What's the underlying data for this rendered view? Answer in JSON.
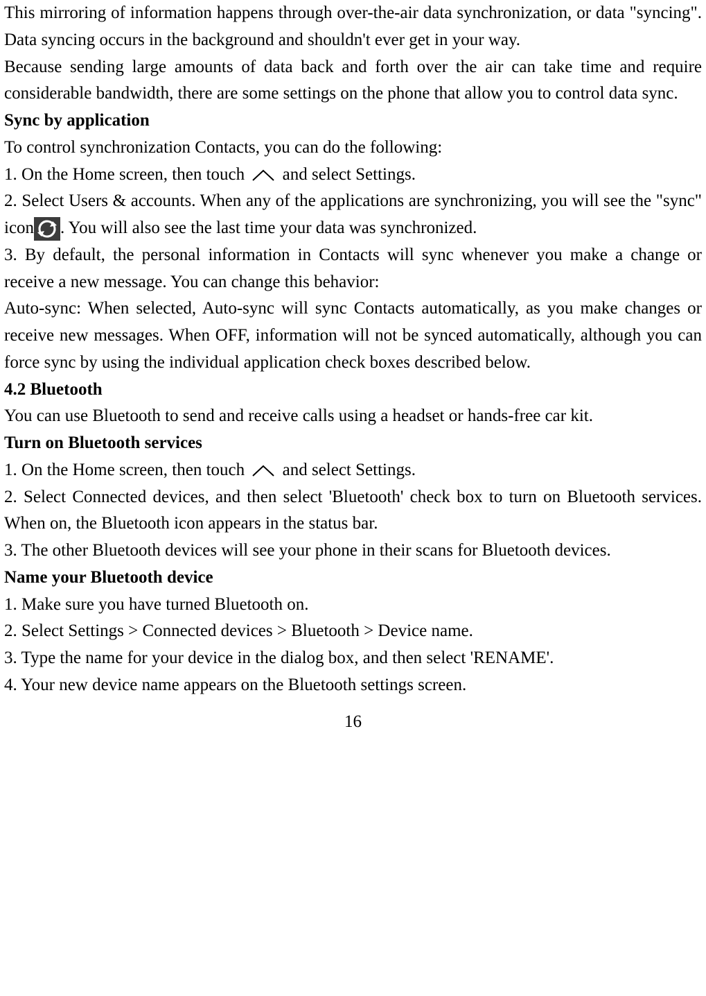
{
  "page_number": "16",
  "intro": {
    "p1": "This mirroring of information happens through over-the-air data synchronization, or data \"syncing\". Data syncing occurs in the background and shouldn't ever get in your way.",
    "p2": "Because sending large amounts of data back and forth over the air can take time and require considerable bandwidth, there are some settings on the phone that allow you to control data sync."
  },
  "sync": {
    "heading": "Sync by application",
    "intro": "To control synchronization Contacts, you can do the following:",
    "step1_a": "1. On the Home screen, then touch ",
    "step1_b": " and select Settings.",
    "step2_a": "2. Select Users & accounts. When any of the applications are synchronizing, you will see the \"sync\" icon",
    "step2_b": ". You will also see the last time your data was synchronized.",
    "step3": "3. By default, the personal information in Contacts will sync whenever you make a change or receive a new message. You can change this behavior:",
    "autosync": "Auto-sync: When selected, Auto-sync will sync Contacts automatically, as you make changes or receive new messages. When OFF, information will not be synced automatically, although you can force sync by using the individual application check boxes described below."
  },
  "bluetooth": {
    "heading": "4.2 Bluetooth",
    "intro": "You can use Bluetooth to send and receive calls using a headset or hands-free car kit.",
    "turn_on": {
      "heading": "Turn on Bluetooth services",
      "step1_a": "1. On the Home screen, then touch ",
      "step1_b": " and select Settings.",
      "step2": "2. Select Connected devices, and then select 'Bluetooth' check box to turn on Bluetooth services. When on, the Bluetooth icon appears in the status bar.",
      "step3": "3. The other Bluetooth devices will see your phone in their scans for Bluetooth devices."
    },
    "name_device": {
      "heading": "Name your Bluetooth device",
      "step1": "1. Make sure you have turned Bluetooth on.",
      "step2": "2. Select Settings > Connected devices > Bluetooth > Device name.",
      "step3": "3. Type the name for your device in the dialog box, and then select 'RENAME'.",
      "step4": "4. Your new device name appears on the Bluetooth settings screen."
    }
  }
}
